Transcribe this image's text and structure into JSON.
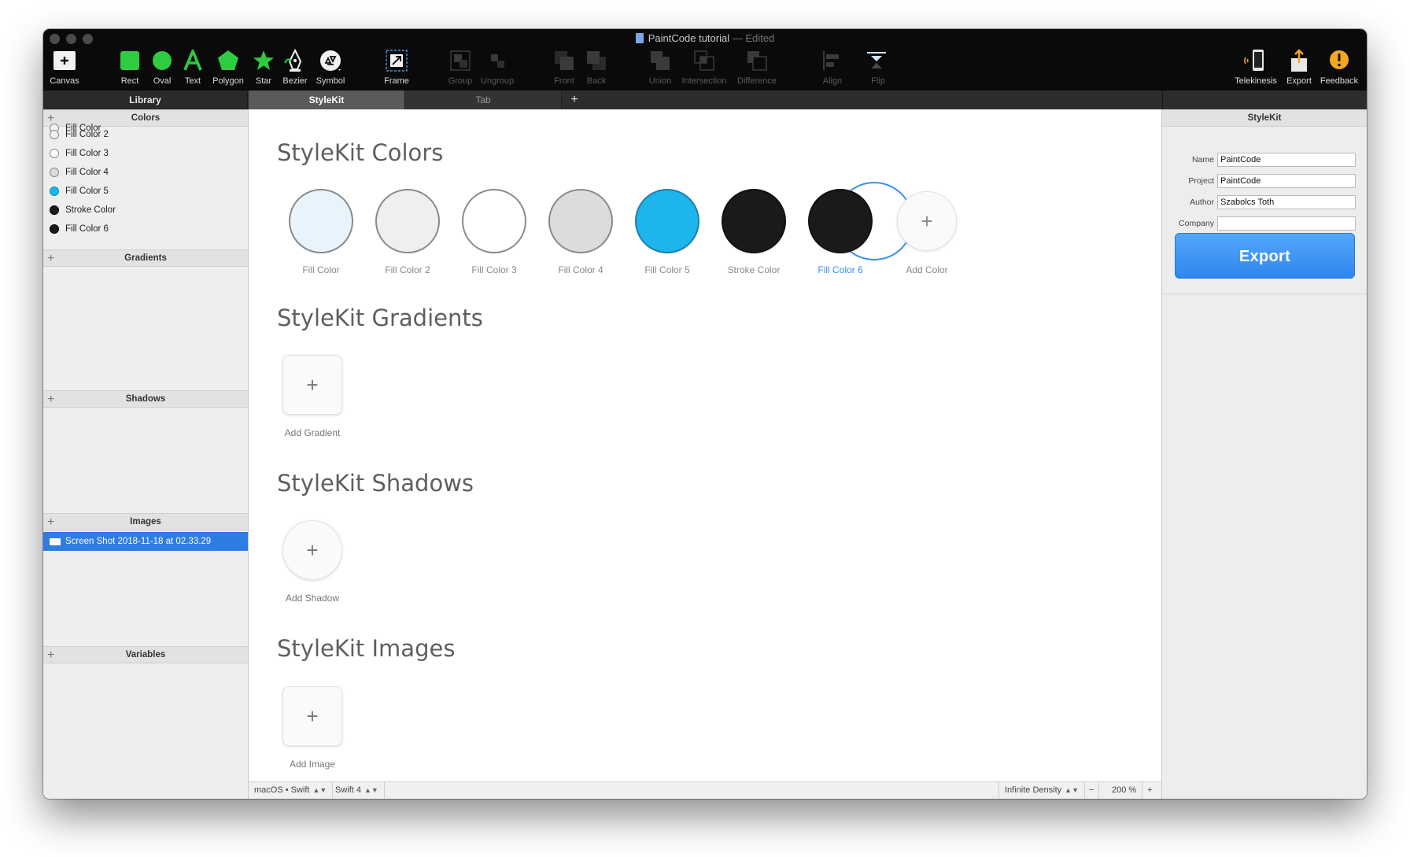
{
  "window": {
    "title": "PaintCode tutorial",
    "edited": "— Edited"
  },
  "toolbar": {
    "canvas": "Canvas",
    "rect": "Rect",
    "oval": "Oval",
    "text": "Text",
    "polygon": "Polygon",
    "star": "Star",
    "bezier": "Bezier",
    "symbol": "Symbol",
    "frame": "Frame",
    "group": "Group",
    "ungroup": "Ungroup",
    "front": "Front",
    "back": "Back",
    "union": "Union",
    "intersection": "Intersection",
    "difference": "Difference",
    "align": "Align",
    "flip": "Flip",
    "telekinesis": "Telekinesis",
    "export": "Export",
    "feedback": "Feedback"
  },
  "tabs": {
    "library": "Library",
    "items": [
      "StyleKit",
      "Tab"
    ],
    "add": "+"
  },
  "library": {
    "colors_header": "Colors",
    "colors": [
      {
        "name": "Fill Color",
        "color": "#e9f3fb"
      },
      {
        "name": "Fill Color 2",
        "color": "#efefef"
      },
      {
        "name": "Fill Color 3",
        "color": "#ffffff"
      },
      {
        "name": "Fill Color 4",
        "color": "#dcdcdc"
      },
      {
        "name": "Fill Color 5",
        "color": "#1eb4ec"
      },
      {
        "name": "Stroke Color",
        "color": "#1a1a1a"
      },
      {
        "name": "Fill Color 6",
        "color": "#1a1a1a"
      }
    ],
    "gradients_header": "Gradients",
    "shadows_header": "Shadows",
    "images_header": "Images",
    "images": [
      "Screen Shot 2018-11-18 at 02.33.29"
    ],
    "variables_header": "Variables"
  },
  "main": {
    "colors_title": "StyleKit Colors",
    "swatches": [
      {
        "name": "Fill Color",
        "color": "#e9f3fb"
      },
      {
        "name": "Fill Color 2",
        "color": "#efefef"
      },
      {
        "name": "Fill Color 3",
        "color": "#ffffff"
      },
      {
        "name": "Fill Color 4",
        "color": "#dcdcdc"
      },
      {
        "name": "Fill Color 5",
        "color": "#1eb4ec"
      },
      {
        "name": "Stroke Color",
        "color": "#1a1a1a"
      },
      {
        "name": "Fill Color 6",
        "color": "#1a1a1a"
      }
    ],
    "add_color": "Add Color",
    "gradients_title": "StyleKit Gradients",
    "add_gradient": "Add Gradient",
    "shadows_title": "StyleKit Shadows",
    "add_shadow": "Add Shadow",
    "images_title": "StyleKit Images",
    "add_image": "Add Image",
    "plus": "+"
  },
  "status": {
    "platform": "macOS • Swift",
    "language": "Swift 4",
    "density": "Infinite Density",
    "zoom_out": "−",
    "zoom": "200 %",
    "zoom_in": "+"
  },
  "inspector": {
    "title": "StyleKit",
    "name_label": "Name",
    "name_value": "PaintCode",
    "project_label": "Project",
    "project_value": "PaintCode",
    "author_label": "Author",
    "author_value": "Szabolcs Toth",
    "company_label": "Company",
    "company_value": "",
    "export_button": "Export"
  },
  "colors": {
    "accent": "#3b8ef0",
    "toolbar_green": "#2ecc40",
    "selection_blue": "#2f7de1"
  }
}
